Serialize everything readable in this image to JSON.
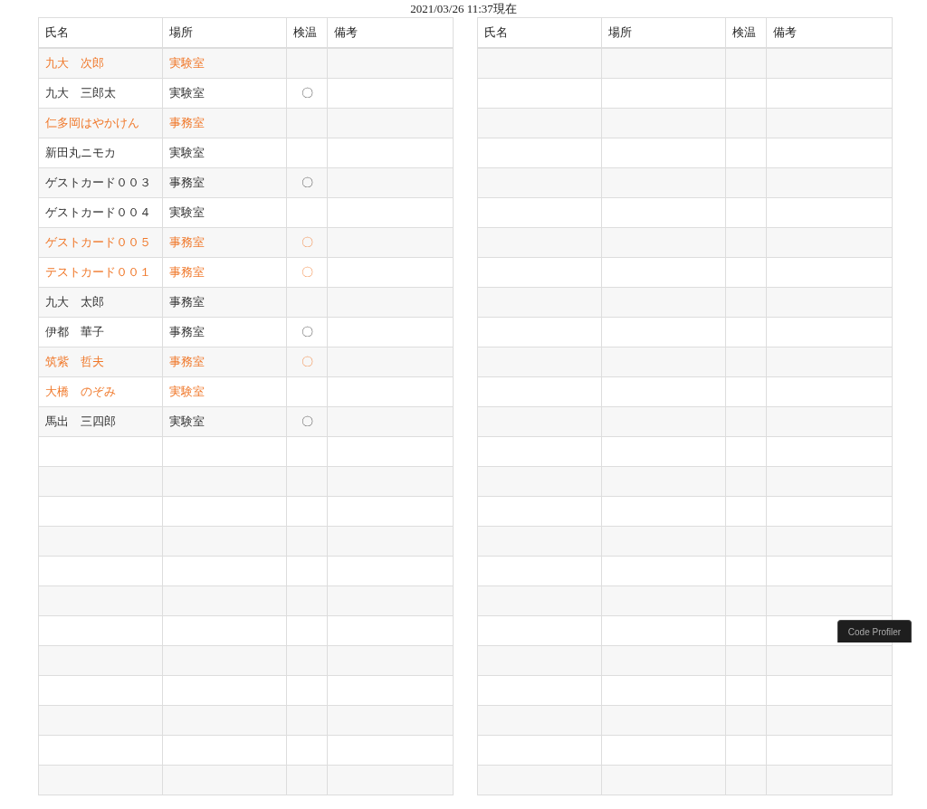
{
  "timestamp": "2021/03/26 11:37現在",
  "tables": [
    {
      "columns": [
        "氏名",
        "場所",
        "検温",
        "備考"
      ],
      "rows": [
        {
          "name": "九大　次郎",
          "place": "実験室",
          "highlighted": true
        },
        {
          "name": "九大　三郎太",
          "place": "実験室",
          "temp": "〇",
          "highlighted": false
        },
        {
          "name": "仁多岡はやかけん",
          "place": "事務室",
          "highlighted": true
        },
        {
          "name": "新田丸ニモカ",
          "place": "実験室",
          "highlighted": false
        },
        {
          "name": "ゲストカード００３",
          "place": "事務室",
          "temp": "〇",
          "highlighted": false
        },
        {
          "name": "ゲストカード００４",
          "place": "実験室",
          "highlighted": false
        },
        {
          "name": "ゲストカード００５",
          "place": "事務室",
          "temp": "〇",
          "highlighted": true
        },
        {
          "name": "テストカード００１",
          "place": "事務室",
          "temp": "〇",
          "highlighted": true
        },
        {
          "name": "九大　太郎",
          "place": "事務室",
          "highlighted": false
        },
        {
          "name": "伊都　華子",
          "place": "事務室",
          "temp": "〇",
          "highlighted": false
        },
        {
          "name": "筑紫　哲夫",
          "place": "事務室",
          "temp": "〇",
          "highlighted": true
        },
        {
          "name": "大橋　のぞみ",
          "place": "実験室",
          "highlighted": true
        },
        {
          "name": "馬出　三四郎",
          "place": "実験室",
          "temp": "〇",
          "highlighted": false
        },
        {},
        {},
        {},
        {},
        {},
        {},
        {},
        {},
        {},
        {},
        {},
        {}
      ]
    },
    {
      "columns": [
        "氏名",
        "場所",
        "検温",
        "備考"
      ],
      "rows": [
        {},
        {},
        {},
        {},
        {},
        {},
        {},
        {},
        {},
        {},
        {},
        {},
        {},
        {},
        {},
        {},
        {},
        {},
        {},
        {},
        {},
        {},
        {},
        {},
        {}
      ]
    }
  ],
  "overlay_tab": {
    "label": "Code Profiler"
  }
}
